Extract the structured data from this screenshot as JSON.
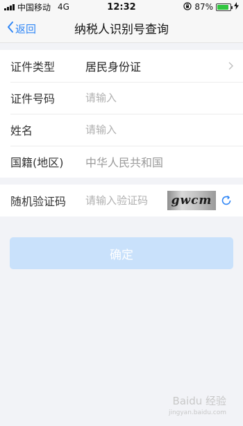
{
  "status_bar": {
    "carrier": "中国移动",
    "network": "4G",
    "time": "12:32",
    "battery": "87%",
    "battery_level": 0.87
  },
  "nav": {
    "back_label": "返回",
    "title": "纳税人识别号查询"
  },
  "form": {
    "id_type": {
      "label": "证件类型",
      "value": "居民身份证"
    },
    "id_number": {
      "label": "证件号码",
      "placeholder": "请输入"
    },
    "name": {
      "label": "姓名",
      "placeholder": "请输入"
    },
    "nationality": {
      "label": "国籍(地区)",
      "value": "中华人民共和国"
    }
  },
  "captcha": {
    "label": "随机验证码",
    "placeholder": "请输入验证码",
    "image_text": "gwcm"
  },
  "confirm_label": "确定",
  "watermark": {
    "text": "Baidu 经验",
    "sub": "jingyan.baidu.com"
  },
  "colors": {
    "accent": "#2f86f6",
    "button_disabled": "#c9e1fb",
    "background": "#f2f3f7"
  }
}
